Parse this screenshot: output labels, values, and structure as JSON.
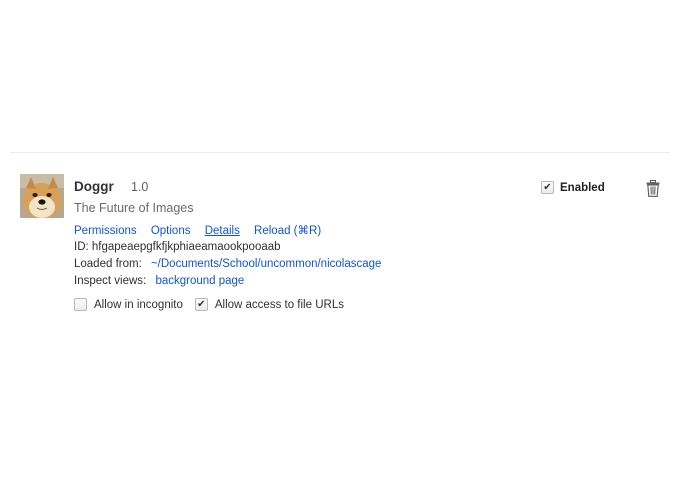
{
  "extension": {
    "name": "Doggr",
    "version": "1.0",
    "description": "The Future of Images",
    "links": {
      "permissions": "Permissions",
      "options": "Options",
      "details": "Details",
      "reload": "Reload (⌘R)"
    },
    "id_label": "ID:",
    "id_value": "hfgapeaepgfkfjkphiaeamaookpooaab",
    "loaded_from_label": "Loaded from:",
    "loaded_from_path": "~/Documents/School/uncommon/nicolascage",
    "inspect_views_label": "Inspect views:",
    "inspect_views_link": "background page",
    "options": {
      "incognito_label": "Allow in incognito",
      "incognito_checked": false,
      "file_urls_label": "Allow access to file URLs",
      "file_urls_checked": true
    },
    "enabled_label": "Enabled",
    "enabled_checked": true,
    "icon": "doge-icon",
    "trash_icon": "trash-icon"
  },
  "colors": {
    "link": "#1155cc",
    "text": "#303030",
    "divider": "#ececec"
  }
}
